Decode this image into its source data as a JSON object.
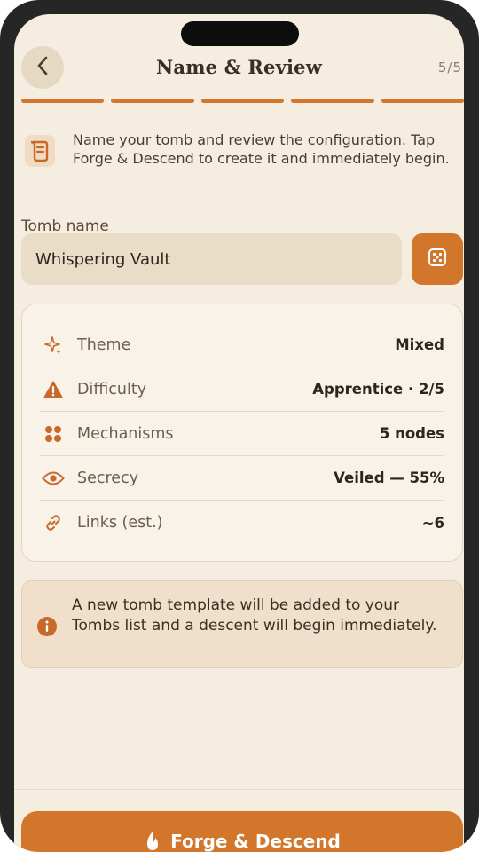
{
  "header": {
    "title": "Name & Review",
    "step": "5/5",
    "progress_steps": 5,
    "progress_completed": 5
  },
  "intro": {
    "icon": "scroll-icon",
    "text": "Name your tomb and review the configuration. Tap Forge & Descend to create it and immediately begin."
  },
  "tomb_name": {
    "label": "Tomb name",
    "value": "Whispering Vault",
    "randomize_icon": "dice-icon"
  },
  "summary": [
    {
      "icon": "sparkle-icon",
      "label": "Theme",
      "value": "Mixed"
    },
    {
      "icon": "warning-icon",
      "label": "Difficulty",
      "value": "Apprentice · 2/5"
    },
    {
      "icon": "nodes-icon",
      "label": "Mechanisms",
      "value": "5 nodes"
    },
    {
      "icon": "eye-icon",
      "label": "Secrecy",
      "value": "Veiled — 55%"
    },
    {
      "icon": "link-icon",
      "label": "Links (est.)",
      "value": "~6"
    }
  ],
  "notice": {
    "icon": "info-icon",
    "text": "A new tomb template will be added to your Tombs list and a descent will begin immediately."
  },
  "cta": {
    "label": "Forge & Descend",
    "icon": "flame-icon"
  },
  "colors": {
    "accent": "#d2762c",
    "background": "#f4ede0",
    "card": "#f8f2e8"
  }
}
